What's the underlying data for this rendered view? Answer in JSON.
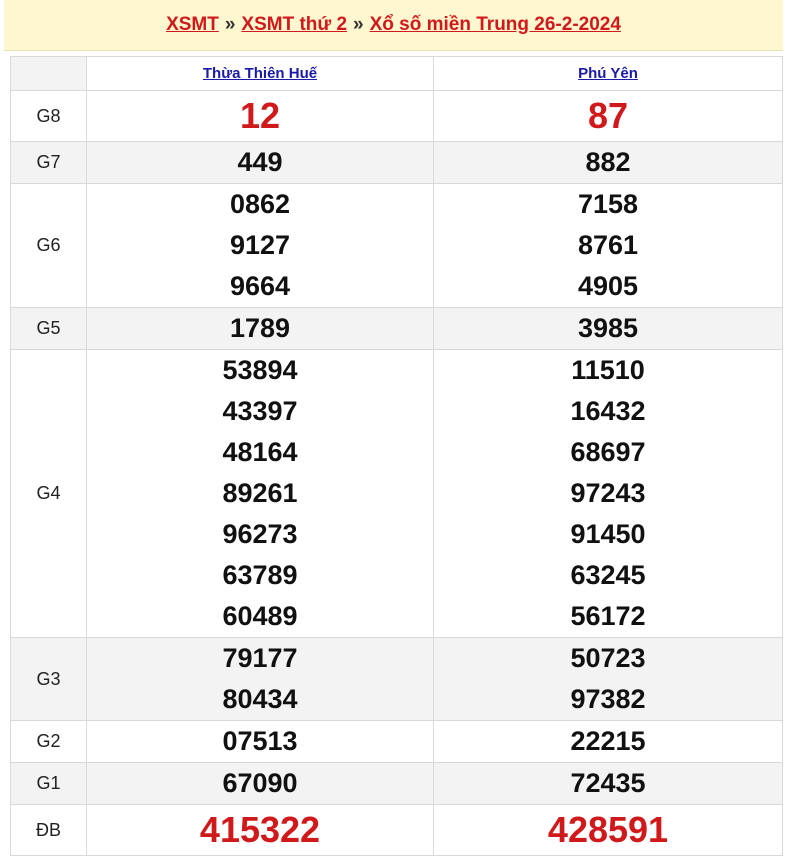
{
  "breadcrumb": {
    "link1": "XSMT",
    "link2": "XSMT thứ 2",
    "link3": "Xổ số miền Trung 26-2-2024",
    "separator": "»"
  },
  "table": {
    "provinces": [
      "Thừa Thiên Huế",
      "Phú Yên"
    ],
    "prizes": [
      {
        "label": "G8",
        "values": [
          [
            "12"
          ],
          [
            "87"
          ]
        ]
      },
      {
        "label": "G7",
        "values": [
          [
            "449"
          ],
          [
            "882"
          ]
        ]
      },
      {
        "label": "G6",
        "values": [
          [
            "0862",
            "9127",
            "9664"
          ],
          [
            "7158",
            "8761",
            "4905"
          ]
        ]
      },
      {
        "label": "G5",
        "values": [
          [
            "1789"
          ],
          [
            "3985"
          ]
        ]
      },
      {
        "label": "G4",
        "values": [
          [
            "53894",
            "43397",
            "48164",
            "89261",
            "96273",
            "63789",
            "60489"
          ],
          [
            "11510",
            "16432",
            "68697",
            "97243",
            "91450",
            "63245",
            "56172"
          ]
        ]
      },
      {
        "label": "G3",
        "values": [
          [
            "79177",
            "80434"
          ],
          [
            "50723",
            "97382"
          ]
        ]
      },
      {
        "label": "G2",
        "values": [
          [
            "07513"
          ],
          [
            "22215"
          ]
        ]
      },
      {
        "label": "G1",
        "values": [
          [
            "67090"
          ],
          [
            "72435"
          ]
        ]
      },
      {
        "label": "ĐB",
        "values": [
          [
            "415322"
          ],
          [
            "428591"
          ]
        ]
      }
    ]
  },
  "colors": {
    "accent_red": "#d0191b",
    "link_blue": "#1a1aa8",
    "header_bg": "#fff7cf",
    "alt_row_bg": "#f3f3f3"
  }
}
